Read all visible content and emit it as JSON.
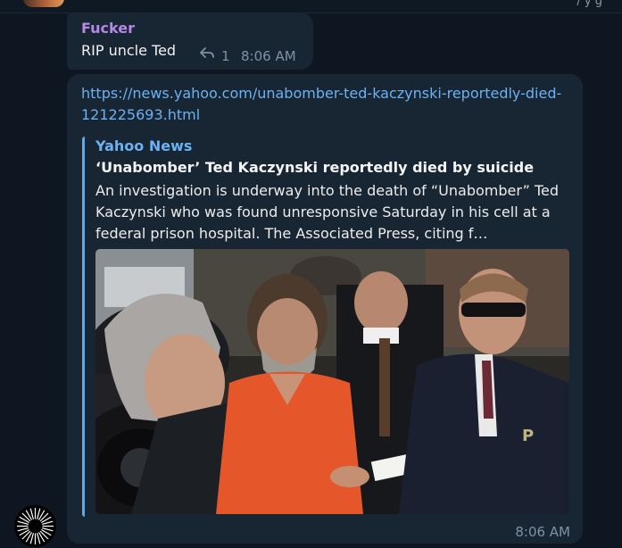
{
  "chat": {
    "messages": [
      {
        "sender": "Fucker",
        "text": "RIP uncle Ted",
        "reply_count": "1",
        "time": "8:06 AM"
      },
      {
        "link": "https://news.yahoo.com/unabomber-ted-kaczynski-reportedly-died-121225693.html",
        "preview": {
          "site": "Yahoo News",
          "title": "‘Unabomber’ Ted Kaczynski reportedly died by suicide",
          "description": "An investigation is underway into the death of “Unabomber” Ted Kaczynski who was found unresponsive Saturday in his cell at a federal prison hospital. The Associated Press, citing f…"
        },
        "time": "8:06 AM"
      }
    ]
  },
  "colors": {
    "background": "#0e1621",
    "bubble": "#182533",
    "sender_name": "#b588e6",
    "link": "#6ab2f2",
    "meta": "#7f91a4"
  },
  "icons": [
    "reply-icon",
    "avatar"
  ]
}
